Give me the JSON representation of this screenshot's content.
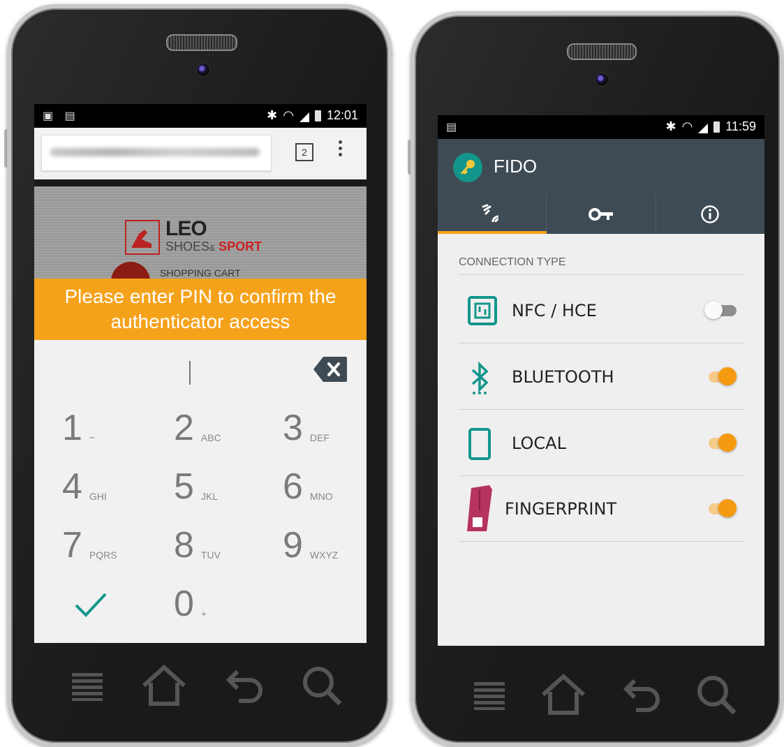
{
  "left_phone": {
    "status": {
      "time": "12:01"
    },
    "browser": {
      "tab_count": "2"
    },
    "webpage": {
      "brand_word": "LEO",
      "brand_sub_a": "SHOES",
      "brand_amp": "&",
      "brand_sub_b": "SPORT",
      "cart_label": "SHOPPING CART"
    },
    "pin_prompt": "Please enter PIN to confirm the authenticator access",
    "keys": [
      {
        "num": "1",
        "letters": "~"
      },
      {
        "num": "2",
        "letters": "ABC"
      },
      {
        "num": "3",
        "letters": "DEF"
      },
      {
        "num": "4",
        "letters": "GHI"
      },
      {
        "num": "5",
        "letters": "JKL"
      },
      {
        "num": "6",
        "letters": "MNO"
      },
      {
        "num": "7",
        "letters": "PQRS"
      },
      {
        "num": "8",
        "letters": "TUV"
      },
      {
        "num": "9",
        "letters": "WXYZ"
      },
      {
        "num": "0",
        "letters": "+"
      }
    ],
    "confirm_key": "✓"
  },
  "right_phone": {
    "status": {
      "time": "11:59"
    },
    "app_title": "FIDO",
    "section_header": "CONNECTION TYPE",
    "connections": [
      {
        "label": "NFC / HCE",
        "icon": "nfc-icon",
        "enabled": false
      },
      {
        "label": "BLUETOOTH",
        "icon": "bluetooth-icon",
        "enabled": true
      },
      {
        "label": "LOCAL",
        "icon": "phone-icon",
        "enabled": true
      },
      {
        "label": "FINGERPRINT",
        "icon": "fingerprint-reader-icon",
        "enabled": true
      }
    ]
  },
  "colors": {
    "accent_orange": "#f5a21b",
    "teal": "#12968b",
    "appbar": "#3e4b55"
  }
}
